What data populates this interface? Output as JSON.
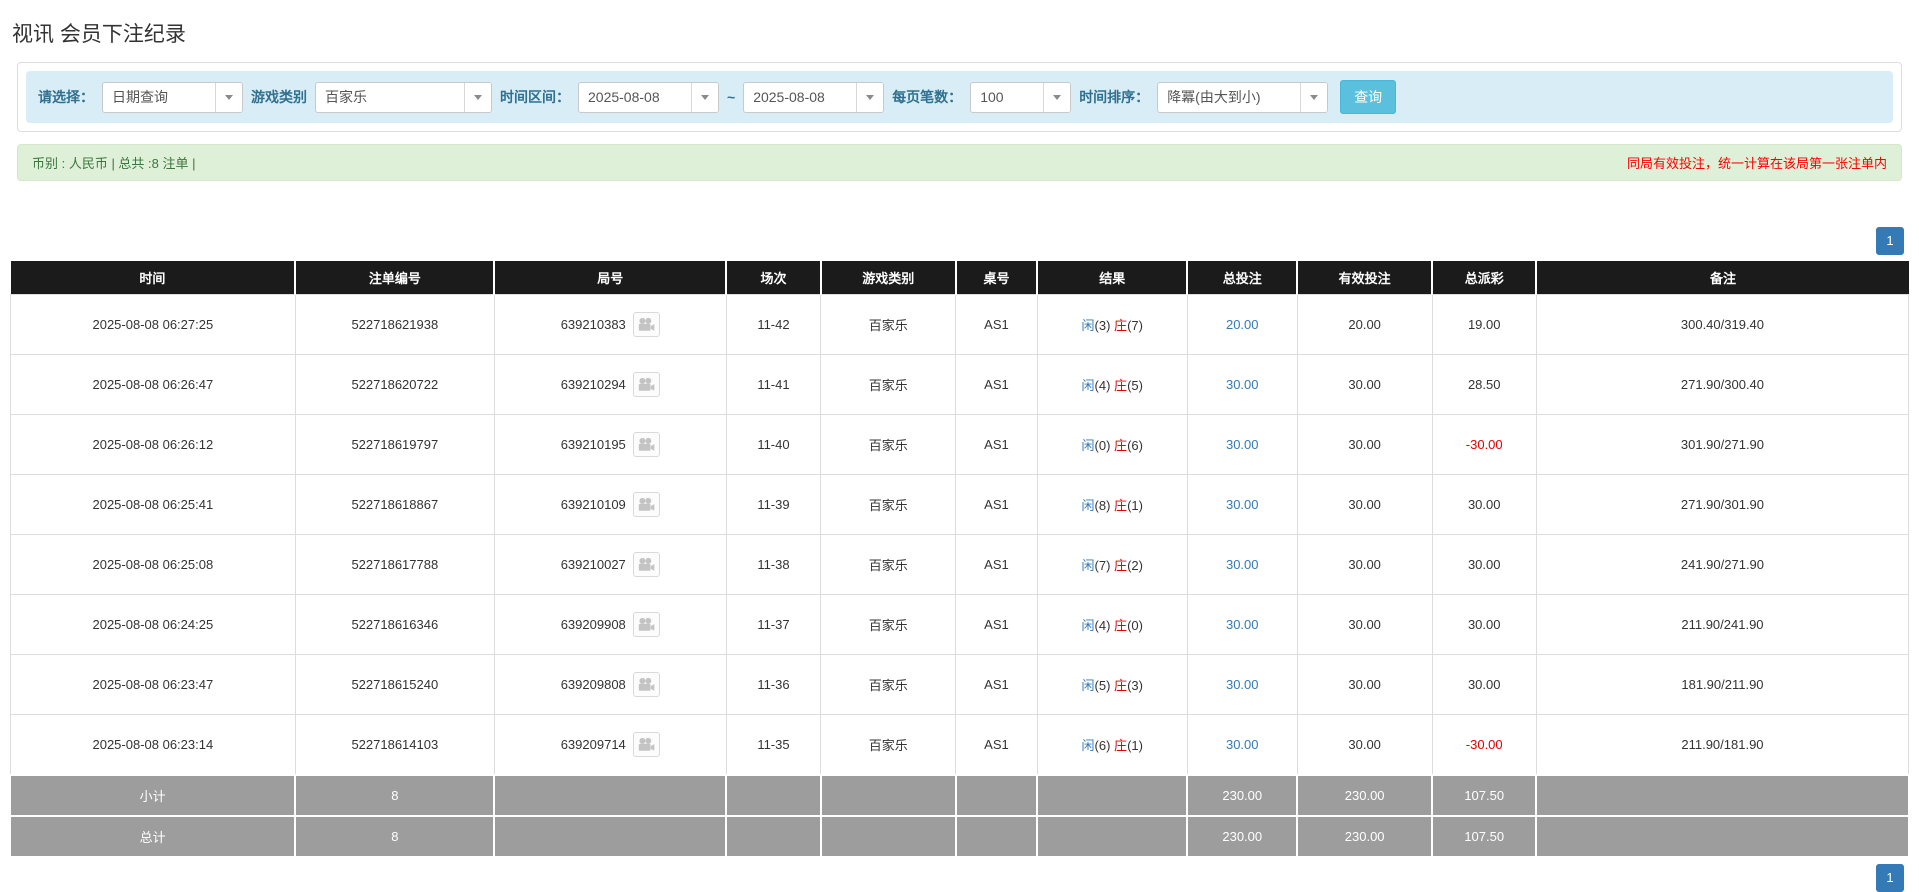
{
  "title": "视讯 会员下注纪录",
  "filters": {
    "select_label": "请选择：",
    "select_value": "日期查询",
    "game_type_label": "游戏类别",
    "game_type_value": "百家乐",
    "time_range_label": "时间区间：",
    "date_from": "2025-08-08",
    "date_separator": "~",
    "date_to": "2025-08-08",
    "page_size_label": "每页笔数：",
    "page_size_value": "100",
    "sort_label": "时间排序：",
    "sort_value": "降冪(由大到小)",
    "search_button": "查询"
  },
  "info_bar": {
    "summary": "币别 : 人民币 | 总共 :8 注单 |",
    "notice": "同局有效投注，统一计算在该局第一张注单内"
  },
  "pagination": {
    "pages": [
      "1"
    ]
  },
  "colors": {
    "filter_bar_bg": "#d9edf7",
    "search_button": "#5bc0de",
    "info_bar_bg": "#dff0d8",
    "info_text_green": "#3c763d",
    "notice_red": "#ff0000",
    "header_bg": "#1b1b1b",
    "summary_bg": "#9d9d9d",
    "link_blue": "#337ab7",
    "player_blue": "#337ab7",
    "banker_red": "#e60000",
    "negative_red": "#e60000",
    "page_button_blue": "#337ab7"
  },
  "table": {
    "columns": [
      "时间",
      "注单编号",
      "局号",
      "场次",
      "游戏类别",
      "桌号",
      "结果",
      "总投注",
      "有效投注",
      "总派彩",
      "备注"
    ],
    "rows": [
      {
        "time": "2025-08-08 06:27:25",
        "bet_no": "522718621938",
        "round_no": "639210383",
        "session": "11-42",
        "game_type": "百家乐",
        "table_no": "AS1",
        "player": "闲",
        "player_n": "(3)",
        "banker": "庄",
        "banker_n": "(7)",
        "total_bet": "20.00",
        "valid_bet": "20.00",
        "payout": "19.00",
        "note": "300.40/319.40"
      },
      {
        "time": "2025-08-08 06:26:47",
        "bet_no": "522718620722",
        "round_no": "639210294",
        "session": "11-41",
        "game_type": "百家乐",
        "table_no": "AS1",
        "player": "闲",
        "player_n": "(4)",
        "banker": "庄",
        "banker_n": "(5)",
        "total_bet": "30.00",
        "valid_bet": "30.00",
        "payout": "28.50",
        "note": "271.90/300.40"
      },
      {
        "time": "2025-08-08 06:26:12",
        "bet_no": "522718619797",
        "round_no": "639210195",
        "session": "11-40",
        "game_type": "百家乐",
        "table_no": "AS1",
        "player": "闲",
        "player_n": "(0)",
        "banker": "庄",
        "banker_n": "(6)",
        "total_bet": "30.00",
        "valid_bet": "30.00",
        "payout": "-30.00",
        "note": "301.90/271.90"
      },
      {
        "time": "2025-08-08 06:25:41",
        "bet_no": "522718618867",
        "round_no": "639210109",
        "session": "11-39",
        "game_type": "百家乐",
        "table_no": "AS1",
        "player": "闲",
        "player_n": "(8)",
        "banker": "庄",
        "banker_n": "(1)",
        "total_bet": "30.00",
        "valid_bet": "30.00",
        "payout": "30.00",
        "note": "271.90/301.90"
      },
      {
        "time": "2025-08-08 06:25:08",
        "bet_no": "522718617788",
        "round_no": "639210027",
        "session": "11-38",
        "game_type": "百家乐",
        "table_no": "AS1",
        "player": "闲",
        "player_n": "(7)",
        "banker": "庄",
        "banker_n": "(2)",
        "total_bet": "30.00",
        "valid_bet": "30.00",
        "payout": "30.00",
        "note": "241.90/271.90"
      },
      {
        "time": "2025-08-08 06:24:25",
        "bet_no": "522718616346",
        "round_no": "639209908",
        "session": "11-37",
        "game_type": "百家乐",
        "table_no": "AS1",
        "player": "闲",
        "player_n": "(4)",
        "banker": "庄",
        "banker_n": "(0)",
        "total_bet": "30.00",
        "valid_bet": "30.00",
        "payout": "30.00",
        "note": "211.90/241.90"
      },
      {
        "time": "2025-08-08 06:23:47",
        "bet_no": "522718615240",
        "round_no": "639209808",
        "session": "11-36",
        "game_type": "百家乐",
        "table_no": "AS1",
        "player": "闲",
        "player_n": "(5)",
        "banker": "庄",
        "banker_n": "(3)",
        "total_bet": "30.00",
        "valid_bet": "30.00",
        "payout": "30.00",
        "note": "181.90/211.90"
      },
      {
        "time": "2025-08-08 06:23:14",
        "bet_no": "522718614103",
        "round_no": "639209714",
        "session": "11-35",
        "game_type": "百家乐",
        "table_no": "AS1",
        "player": "闲",
        "player_n": "(6)",
        "banker": "庄",
        "banker_n": "(1)",
        "total_bet": "30.00",
        "valid_bet": "30.00",
        "payout": "-30.00",
        "note": "211.90/181.90"
      }
    ],
    "footer": [
      {
        "label": "小计",
        "count": "8",
        "total_bet": "230.00",
        "valid_bet": "230.00",
        "payout": "107.50"
      },
      {
        "label": "总计",
        "count": "8",
        "total_bet": "230.00",
        "valid_bet": "230.00",
        "payout": "107.50"
      }
    ]
  }
}
